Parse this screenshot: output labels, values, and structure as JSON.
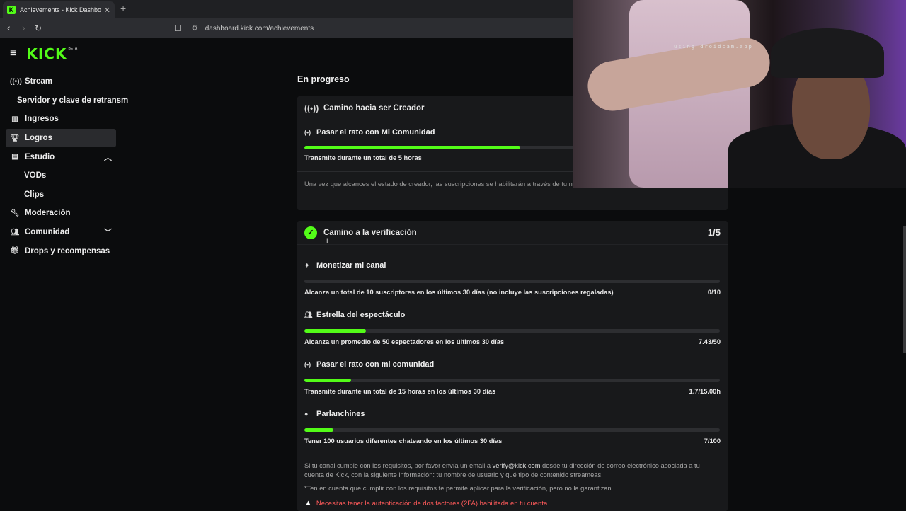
{
  "browser": {
    "tab_title": "Achievements - Kick Dashboard",
    "tab_close": "✕",
    "new_tab": "+",
    "url": "dashboard.kick.com/achievements"
  },
  "header": {
    "logo": "KICK",
    "beta": "BETA"
  },
  "sidebar": {
    "items": [
      {
        "label": "Stream"
      },
      {
        "label": "Servidor y clave de retransm"
      },
      {
        "label": "Ingresos"
      },
      {
        "label": "Logros"
      },
      {
        "label": "Estudio"
      },
      {
        "label": "VODs"
      },
      {
        "label": "Clips"
      },
      {
        "label": "Moderación"
      },
      {
        "label": "Comunidad"
      },
      {
        "label": "Drops y recompensas"
      }
    ]
  },
  "main": {
    "section_title": "En progreso",
    "creator_card": {
      "title": "Camino hacia ser Creador",
      "goal": {
        "title": "Pasar el rato con Mi Comunidad",
        "description": "Transmite durante un total de 5 horas",
        "progress": 0.52
      },
      "note": "Una vez que alcances el estado de creador, las suscripciones se habilitarán a través de tu nueva página de ingresos"
    },
    "verification_card": {
      "title": "Camino a la verificación",
      "count": "1/5",
      "goals": [
        {
          "title": "Monetizar mi canal",
          "description": "Alcanza un total de 10 suscriptores en los últimos 30 días (no incluye las suscripciones regaladas)",
          "value": "0/10",
          "progress": 0.0
        },
        {
          "title": "Estrella del espectáculo",
          "description": "Alcanza un promedio de 50 espectadores en los últimos 30 días",
          "value": "7.43/50",
          "progress": 0.149
        },
        {
          "title": "Pasar el rato con mi comunidad",
          "description": "Transmite durante un total de 15 horas en los últimos 30 días",
          "value": "1.7/15.00h",
          "progress": 0.113
        },
        {
          "title": "Parlanchines",
          "description": "Tener 100 usuarios diferentes chateando en los últimos 30 días",
          "value": "7/100",
          "progress": 0.07
        }
      ],
      "footer_1": "Si tu canal cumple con los requisitos, por favor envía un email a",
      "email": "verify@kick.com",
      "footer_2": "desde tu dirección de correo electrónico asociada a tu cuenta de Kick, con la siguiente información: tu nombre de usuario y qué tipo de contenido streameas.",
      "footer_3": "*Ten en cuenta que cumplir con los requisitos te permite aplicar para la verificación, pero no la garantizan.",
      "warning": "Necesitas tener la autenticación de dos factores (2FA) habilitada en tu cuenta"
    }
  },
  "webcam": {
    "overlay_text": "using droidcam.app"
  },
  "colors": {
    "accent": "#53fc18",
    "warning": "#ff5a5a"
  }
}
